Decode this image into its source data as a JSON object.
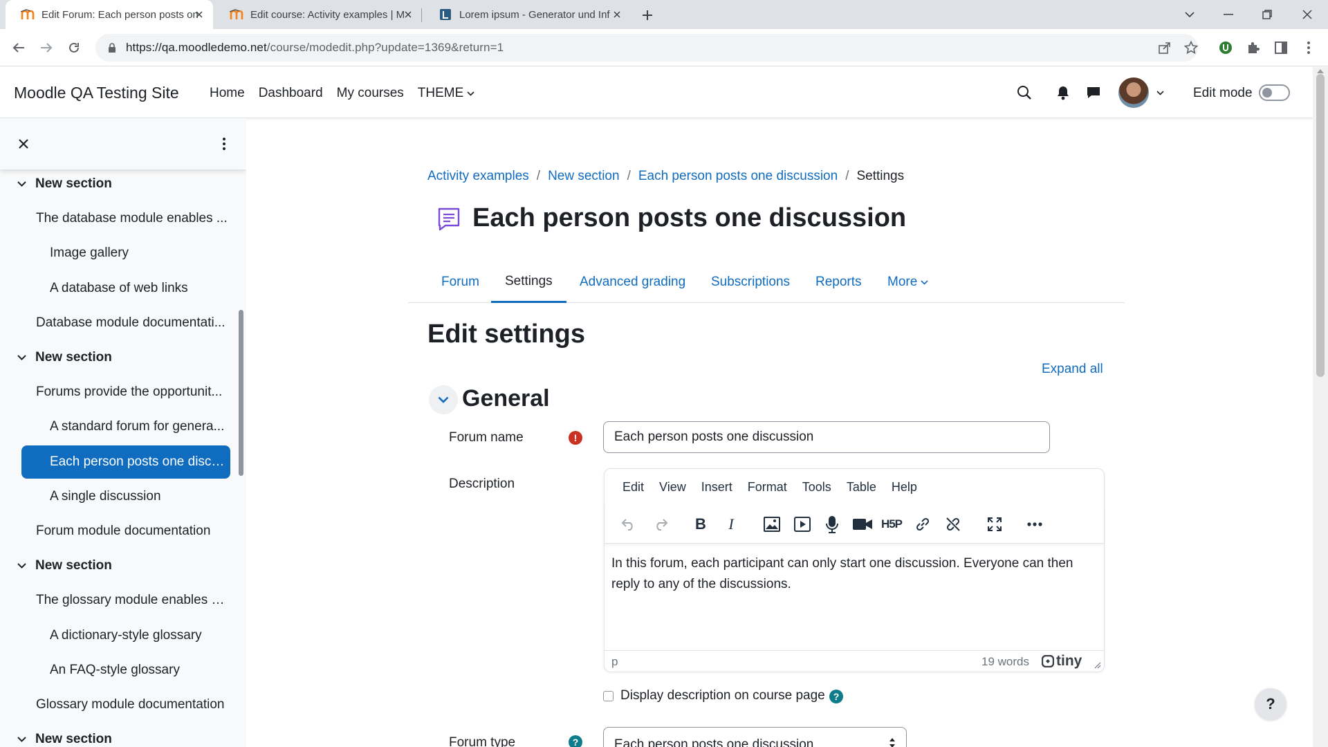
{
  "browser": {
    "tabs": [
      {
        "title": "Edit Forum: Each person posts on",
        "active": true
      },
      {
        "title": "Edit course: Activity examples | M",
        "active": false
      },
      {
        "title": "Lorem ipsum - Generator und Inf",
        "active": false
      }
    ],
    "url_host": "https://qa.moodledemo.net",
    "url_path": "/course/modedit.php?update=1369&return=1"
  },
  "navbar": {
    "site_name": "Moodle QA Testing Site",
    "items": [
      "Home",
      "Dashboard",
      "My courses",
      "THEME"
    ],
    "edit_mode_label": "Edit mode"
  },
  "course_index": {
    "items": [
      {
        "label": "New section",
        "type": "section"
      },
      {
        "label": "The database module enables ...",
        "type": "activity"
      },
      {
        "label": "Image gallery",
        "type": "sub"
      },
      {
        "label": "A database of web links",
        "type": "sub"
      },
      {
        "label": "Database module documentati...",
        "type": "activity"
      },
      {
        "label": "New section",
        "type": "section"
      },
      {
        "label": "Forums provide the opportunit...",
        "type": "activity"
      },
      {
        "label": "A standard forum for genera...",
        "type": "sub"
      },
      {
        "label": "Each person posts one discu...",
        "type": "sub",
        "active": true
      },
      {
        "label": "A single discussion",
        "type": "sub"
      },
      {
        "label": "Forum module documentation",
        "type": "activity"
      },
      {
        "label": "New section",
        "type": "section"
      },
      {
        "label": "The glossary module enables p...",
        "type": "activity"
      },
      {
        "label": "A dictionary-style glossary",
        "type": "sub"
      },
      {
        "label": "An FAQ-style glossary",
        "type": "sub"
      },
      {
        "label": "Glossary module documentation",
        "type": "activity"
      },
      {
        "label": "New section",
        "type": "section"
      }
    ]
  },
  "breadcrumb": {
    "items": [
      "Activity examples",
      "New section",
      "Each person posts one discussion"
    ],
    "current": "Settings"
  },
  "page": {
    "title": "Each person posts one discussion",
    "tabs": [
      "Forum",
      "Settings",
      "Advanced grading",
      "Subscriptions",
      "Reports",
      "More"
    ],
    "active_tab": "Settings",
    "heading": "Edit settings",
    "expand_all": "Expand all"
  },
  "general": {
    "title": "General",
    "forum_name_label": "Forum name",
    "forum_name_value": "Each person posts one discussion",
    "description_label": "Description",
    "editor": {
      "menus": [
        "Edit",
        "View",
        "Insert",
        "Format",
        "Tools",
        "Table",
        "Help"
      ],
      "content": "In this forum, each participant can only start one discussion. Everyone can then reply to any of the discussions.",
      "status_path": "p",
      "word_count": "19 words",
      "brand": "tiny"
    },
    "display_description_label": "Display description on course page",
    "forum_type_label": "Forum type",
    "forum_type_value": "Each person posts one discussion"
  },
  "float_help": "?"
}
